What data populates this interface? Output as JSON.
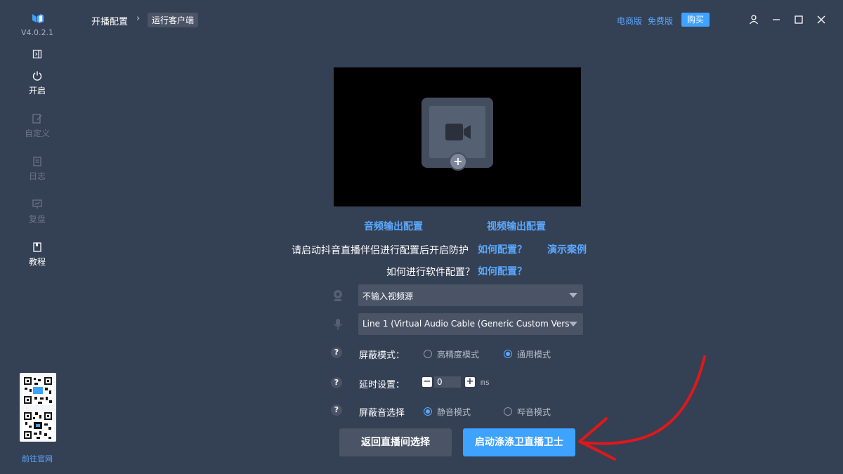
{
  "sidebar": {
    "version": "V4.0.2.1",
    "items": [
      {
        "label": "开启",
        "icon": "power-icon"
      },
      {
        "label": "自定义",
        "icon": "edit-icon"
      },
      {
        "label": "日志",
        "icon": "log-icon"
      },
      {
        "label": "复盘",
        "icon": "review-icon"
      },
      {
        "label": "教程",
        "icon": "book-icon"
      }
    ],
    "site_link": "前往官网"
  },
  "header": {
    "breadcrumb_root": "开播配置",
    "breadcrumb_sep": "›",
    "breadcrumb_current": "运行客户端",
    "link_ecommerce": "电商版",
    "link_free": "免费版",
    "buy_label": "购买"
  },
  "main": {
    "audio_config": "音频输出配置",
    "video_config": "视频输出配置",
    "hint_text": "请启动抖音直播伴侣进行配置后开启防护",
    "how_config_1": "如何配置？",
    "demo_case": "演示案例",
    "software_q": "如何进行软件配置？",
    "how_config_2": "如何配置？",
    "video_source": "不输入视频源",
    "audio_source": "Line 1 (Virtual Audio Cable (Generic Custom Vers",
    "shield_mode_label": "屏蔽模式：",
    "shield_mode_options": [
      "高精度模式",
      "通用模式"
    ],
    "shield_mode_selected": "通用模式",
    "delay_label": "延时设置：",
    "delay_value": "0",
    "delay_unit": "ms",
    "minus": "−",
    "plus": "+",
    "help": "?",
    "sound_label": "屏蔽音选择",
    "sound_options": [
      "静音模式",
      "哔音模式"
    ],
    "sound_selected": "静音模式",
    "back_button": "返回直播间选择",
    "start_button": "启动涤涤卫直播卫士"
  },
  "colors": {
    "background": "#344054",
    "accent": "#3ea2ff",
    "link": "#5aa9ff",
    "annotation": "#e0181a"
  }
}
